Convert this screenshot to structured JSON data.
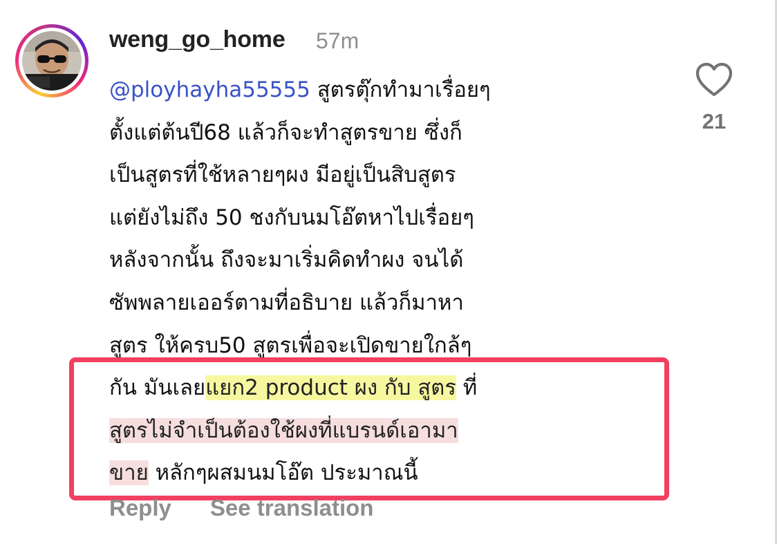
{
  "comment": {
    "username": "weng_go_home",
    "time_ago": "57m",
    "avatar_icon": "profile-photo",
    "mention": "@ployhayha55555",
    "lines": [
      " สูตรตุ๊กทำมาเรื่อยๆ",
      "ตั้งแต่ต้นปี68 แล้วก็จะทำสูตรขาย ซึ่งก็",
      "เป็นสูตรที่ใช้หลายๆผง มีอยู่เป็นสิบสูตร",
      "แต่ยังไม่ถึง 50 ชงกับนมโอ๊ตหาไปเรื่อยๆ",
      "หลังจากนั้น ถึงจะมาเริ่มคิดทำผง จนได้",
      "ซัพพลายเออร์ตามที่อธิบาย แล้วก็มาหา",
      "สูตร ให้ครบ50 สูตรเพื่อจะเปิดขายใกล้ๆ"
    ],
    "line8_prefix": "กัน มันเลย",
    "line8_highlight": "แยก2 product ผง กับ สูตร",
    "line8_suffix": " ที่",
    "line9_highlight": "สูตรไม่จำเป็นต้องใช้ผงที่แบรนด์เอามา",
    "line10_highlight": "ขาย",
    "line10_suffix": " หลักๆผสมนมโอ๊ต ประมาณนี้"
  },
  "like": {
    "icon": "heart-icon",
    "count": "21"
  },
  "actions": {
    "reply_label": "Reply",
    "translate_label": "See translation"
  },
  "colors": {
    "mention": "#3a52c8",
    "highlight_yellow": "#f7f7a0",
    "highlight_pink": "#f6dede",
    "annotation_box": "#f24060",
    "muted_text": "#8e8e8e"
  }
}
